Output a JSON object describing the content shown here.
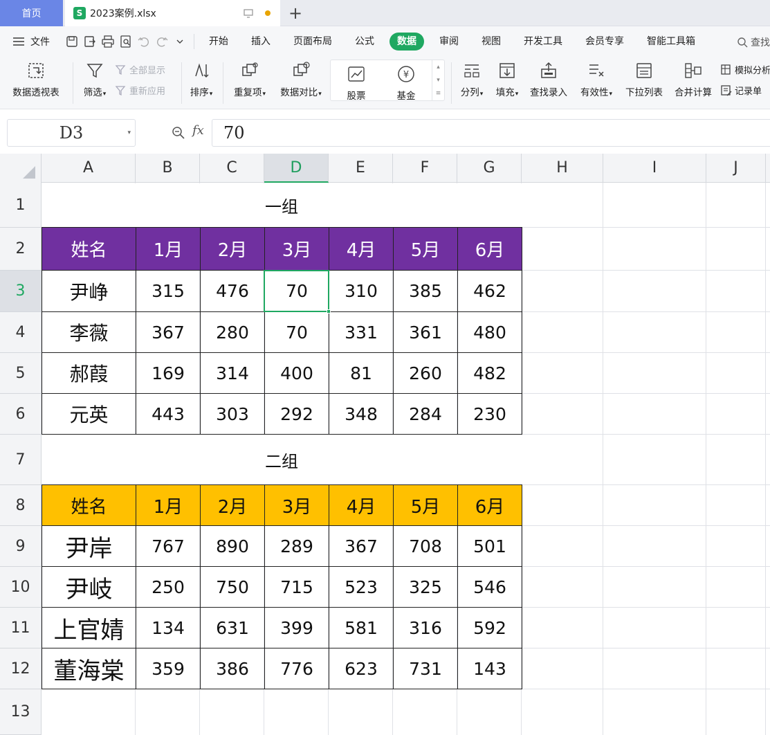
{
  "tabs": {
    "home": "首页",
    "file_icon": "S",
    "file": "2023案例.xlsx",
    "add": "+"
  },
  "menu": {
    "file": "文件",
    "tabs": [
      "开始",
      "插入",
      "页面布局",
      "公式",
      "数据",
      "审阅",
      "视图",
      "开发工具",
      "会员专享",
      "智能工具箱"
    ],
    "active_tab": "数据",
    "search": "查找"
  },
  "ribbon": {
    "pivot": "数据透视表",
    "filter": "筛选",
    "show_all": "全部显示",
    "reapply": "重新应用",
    "sort": "排序",
    "duplicates": "重复项",
    "compare": "数据对比",
    "stock": "股票",
    "fund": "基金",
    "split": "分列",
    "fill": "填充",
    "lookup": "查找录入",
    "validity": "有效性",
    "dropdown": "下拉列表",
    "consolidate": "合并计算",
    "whatif": "模拟分析",
    "record": "记录单",
    "fund_symbol": "¥"
  },
  "formula_bar": {
    "cell_ref": "D3",
    "fx": "fx",
    "value": "70"
  },
  "sheet": {
    "columns": [
      "A",
      "B",
      "C",
      "D",
      "E",
      "F",
      "G",
      "H",
      "I",
      "J"
    ],
    "active_column": "D",
    "rows": [
      "1",
      "2",
      "3",
      "4",
      "5",
      "6",
      "7",
      "8",
      "9",
      "10",
      "11",
      "12",
      "13"
    ],
    "active_row": "3",
    "group1": {
      "title": "一组",
      "header": [
        "姓名",
        "1月",
        "2月",
        "3月",
        "4月",
        "5月",
        "6月"
      ],
      "rows": [
        [
          "尹峥",
          "315",
          "476",
          "70",
          "310",
          "385",
          "462"
        ],
        [
          "李薇",
          "367",
          "280",
          "70",
          "331",
          "361",
          "480"
        ],
        [
          "郝葭",
          "169",
          "314",
          "400",
          "81",
          "260",
          "482"
        ],
        [
          "元英",
          "443",
          "303",
          "292",
          "348",
          "284",
          "230"
        ]
      ]
    },
    "group2": {
      "title": "二组",
      "header": [
        "姓名",
        "1月",
        "2月",
        "3月",
        "4月",
        "5月",
        "6月"
      ],
      "rows": [
        [
          "尹岸",
          "767",
          "890",
          "289",
          "367",
          "708",
          "501"
        ],
        [
          "尹岐",
          "250",
          "750",
          "715",
          "523",
          "325",
          "546"
        ],
        [
          "上官婧",
          "134",
          "631",
          "399",
          "581",
          "316",
          "592"
        ],
        [
          "董海棠",
          "359",
          "386",
          "776",
          "623",
          "731",
          "143"
        ]
      ]
    },
    "colors": {
      "header1_bg": "#7030a0",
      "header2_bg": "#ffc000",
      "accent": "#1fa861"
    }
  }
}
